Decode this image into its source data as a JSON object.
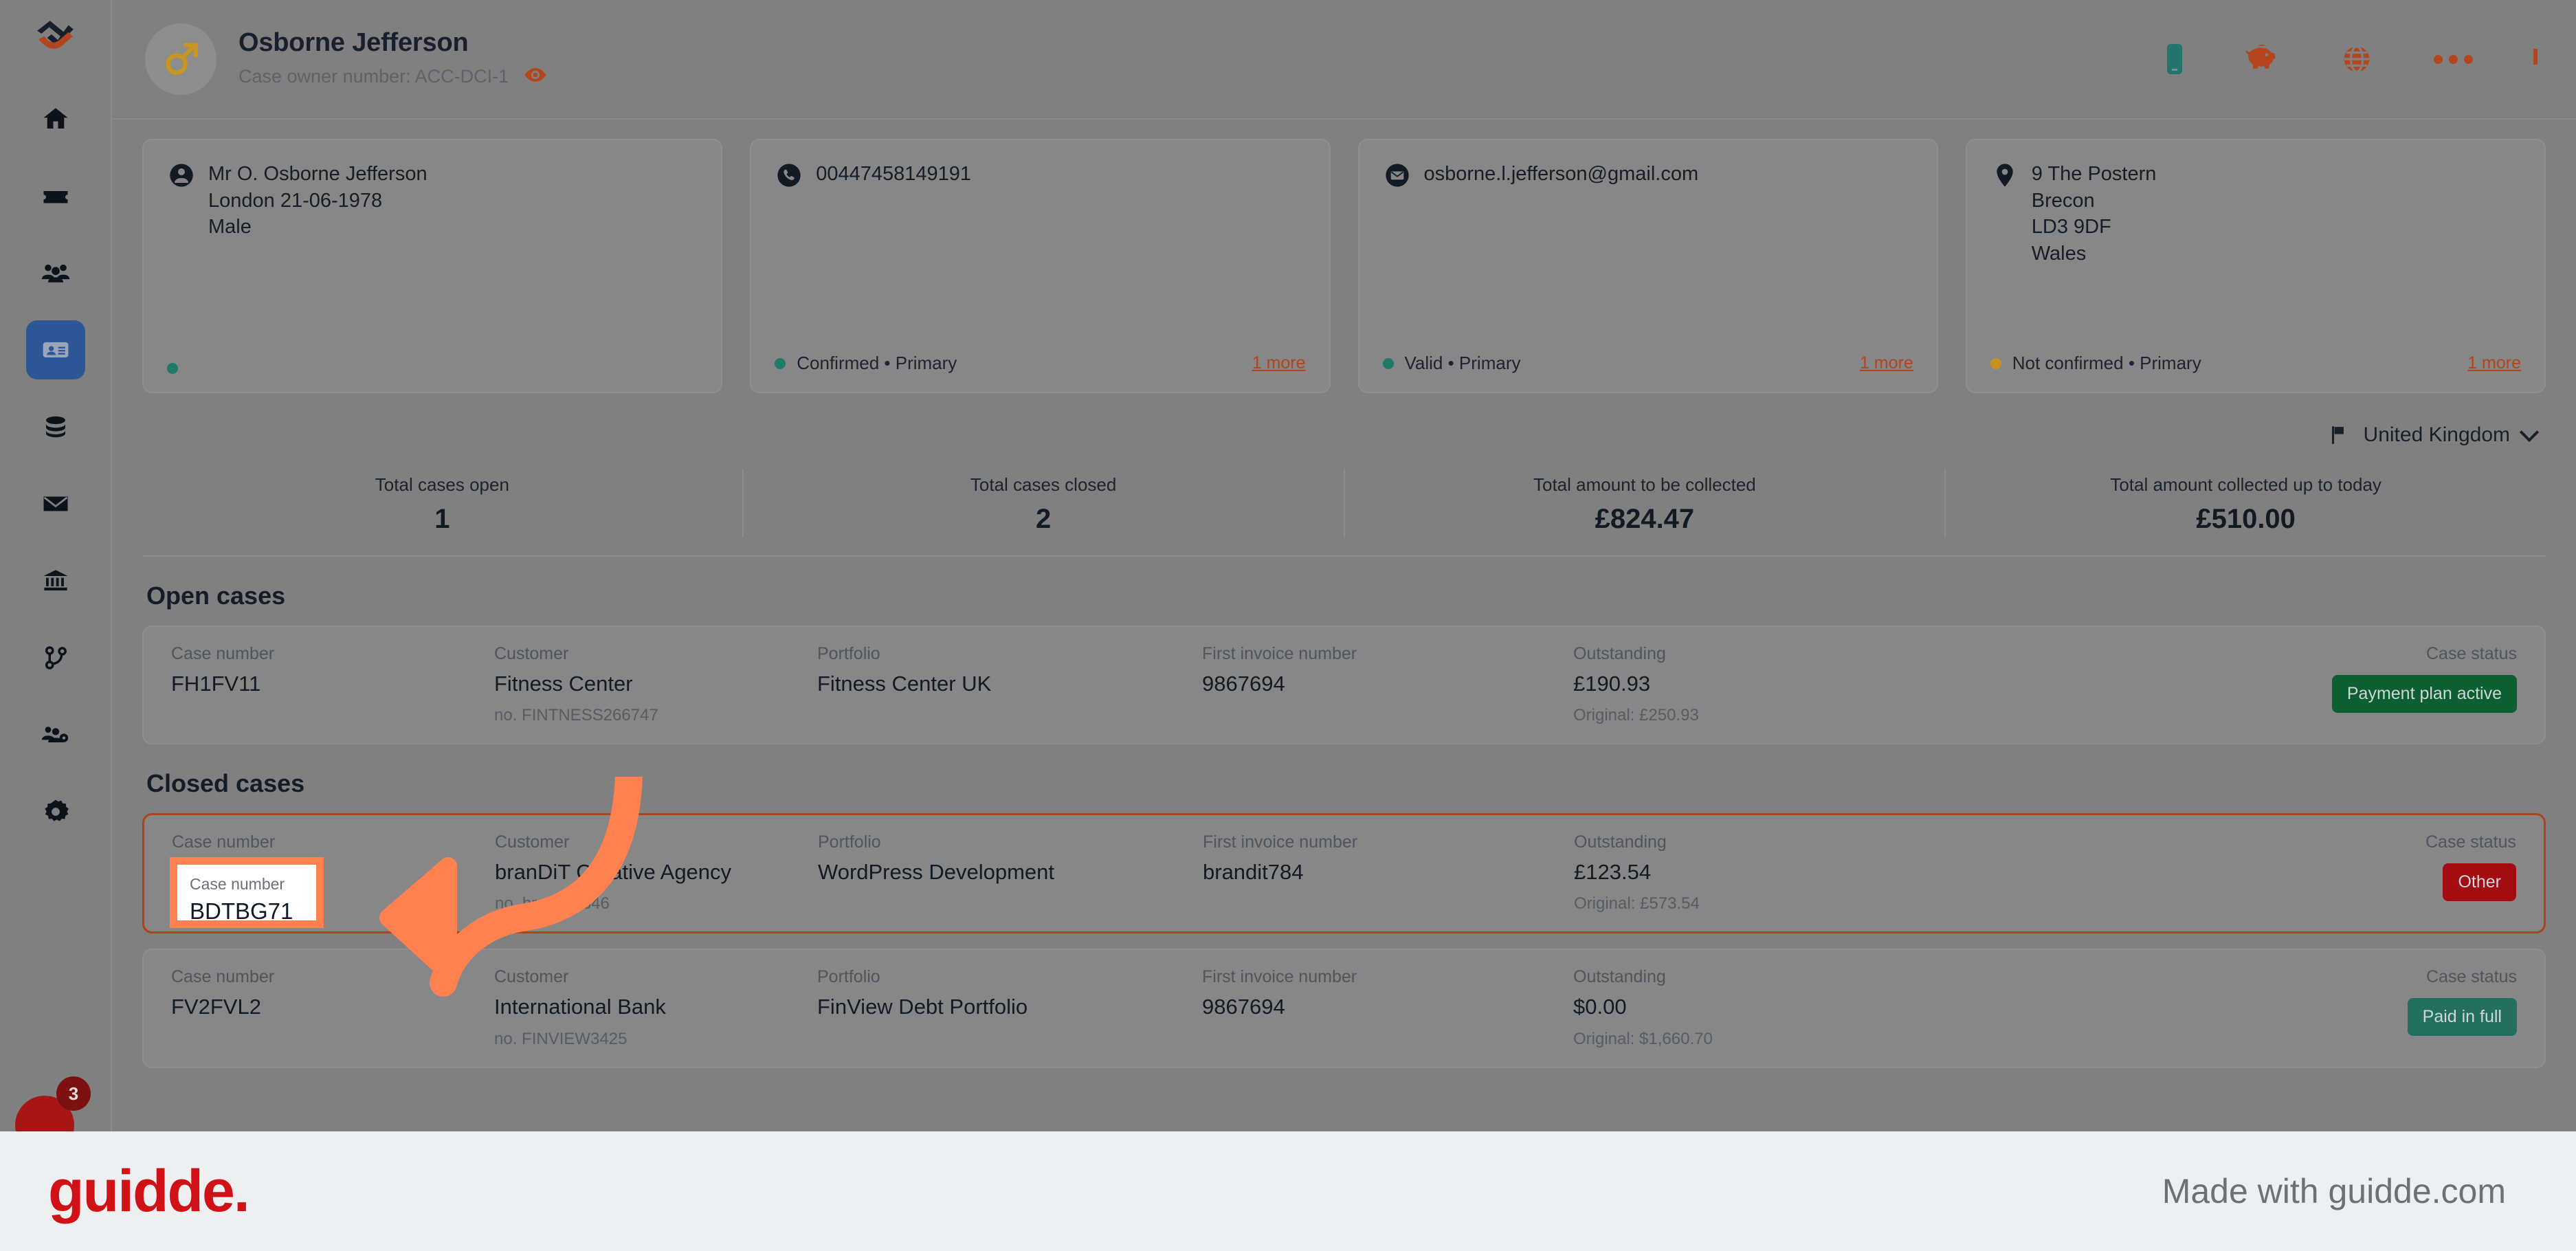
{
  "sidebar": {
    "brand": "fintech-logo",
    "items": [
      {
        "name": "home",
        "icon": "home-icon",
        "active": false
      },
      {
        "name": "tickets",
        "icon": "ticket-icon",
        "active": false
      },
      {
        "name": "customers",
        "icon": "people-icon",
        "active": false
      },
      {
        "name": "contacts",
        "icon": "contact-card-icon",
        "active": true
      },
      {
        "name": "portfolios",
        "icon": "database-icon",
        "active": false
      },
      {
        "name": "messages",
        "icon": "envelope-icon",
        "active": false
      },
      {
        "name": "banks",
        "icon": "bank-icon",
        "active": false
      },
      {
        "name": "workflows",
        "icon": "branch-icon",
        "active": false
      },
      {
        "name": "team-settings",
        "icon": "people-gear-icon",
        "active": false
      },
      {
        "name": "settings",
        "icon": "gear-icon",
        "active": false
      }
    ],
    "support_badge": "3"
  },
  "header": {
    "title": "Osborne Jefferson",
    "subtitle": "Case owner number: ACC-DCI-1",
    "avatar_icon": "male-gender-icon",
    "eye_icon": "eye-icon",
    "actions": [
      {
        "name": "mobile",
        "icon": "phone-device-icon"
      },
      {
        "name": "finance",
        "icon": "piggy-bank-icon"
      },
      {
        "name": "language",
        "icon": "globe-icon"
      },
      {
        "name": "more",
        "icon": "more-dots-icon"
      },
      {
        "name": "collapse",
        "icon": "chevron-up-icon"
      }
    ]
  },
  "cards": [
    {
      "icon": "person-icon",
      "lines": [
        "Mr O. Osborne Jefferson",
        "London 21-06-1978",
        "Male"
      ],
      "status": "",
      "status_color": "#1f7a69",
      "more": ""
    },
    {
      "icon": "phone-icon",
      "lines": [
        "00447458149191"
      ],
      "status": "Confirmed • Primary",
      "status_color": "#1f7a69",
      "more": "1 more"
    },
    {
      "icon": "mail-icon",
      "lines": [
        "osborne.l.jefferson@gmail.com"
      ],
      "status": "Valid • Primary",
      "status_color": "#1f7a69",
      "more": "1 more"
    },
    {
      "icon": "location-pin-icon",
      "lines": [
        "9 The Postern",
        "Brecon",
        "LD3 9DF",
        "Wales"
      ],
      "status": "Not confirmed • Primary",
      "status_color": "#c8931c",
      "more": "1 more"
    }
  ],
  "country_selector": {
    "label": "United Kingdom",
    "flag_icon": "flag-icon",
    "chevron_icon": "chevron-down-icon"
  },
  "stats": [
    {
      "label": "Total cases open",
      "value": "1"
    },
    {
      "label": "Total cases closed",
      "value": "2"
    },
    {
      "label": "Total amount to be collected",
      "value": "£824.47"
    },
    {
      "label": "Total amount collected up to today",
      "value": "£510.00"
    }
  ],
  "columns": {
    "case_number": "Case number",
    "customer": "Customer",
    "portfolio": "Portfolio",
    "first_invoice": "First invoice number",
    "outstanding": "Outstanding",
    "case_status": "Case status"
  },
  "open_cases": {
    "title": "Open cases",
    "rows": [
      {
        "case_number": "FH1FV11",
        "customer": "Fitness Center",
        "customer_no": "no.  FINTNESS266747",
        "portfolio": "Fitness Center UK",
        "first_invoice": "9867694",
        "outstanding": "£190.93",
        "original": "Original:  £250.93",
        "status": "Payment plan active",
        "status_variant": "green"
      }
    ]
  },
  "closed_cases": {
    "title": "Closed cases",
    "rows": [
      {
        "case_number": "BDTBG71",
        "customer": "branDiT Creative Agency",
        "customer_no": "no.  brandit7846",
        "portfolio": "WordPress Development",
        "first_invoice": "brandit784",
        "outstanding": "£123.54",
        "original": "Original:  £573.54",
        "status": "Other",
        "status_variant": "red",
        "highlighted": true
      },
      {
        "case_number": "FV2FVL2",
        "customer": "International Bank",
        "customer_no": "no.  FINVIEW3425",
        "portfolio": "FinView Debt Portfolio",
        "first_invoice": "9867694",
        "outstanding": "$0.00",
        "original": "Original:  $1,660.70",
        "status": "Paid in full",
        "status_variant": "teal",
        "highlighted": false
      }
    ]
  },
  "callout": {
    "label": "Case number",
    "value": "BDTBG71",
    "arrow_color": "#ff8150"
  },
  "footer": {
    "logo": "guidde.",
    "made_with": "Made with guidde.com"
  },
  "colors": {
    "accent_orange": "#ff8150",
    "brand_red": "#d01217",
    "active_nav": "#2d5796",
    "link": "#b4451f"
  }
}
